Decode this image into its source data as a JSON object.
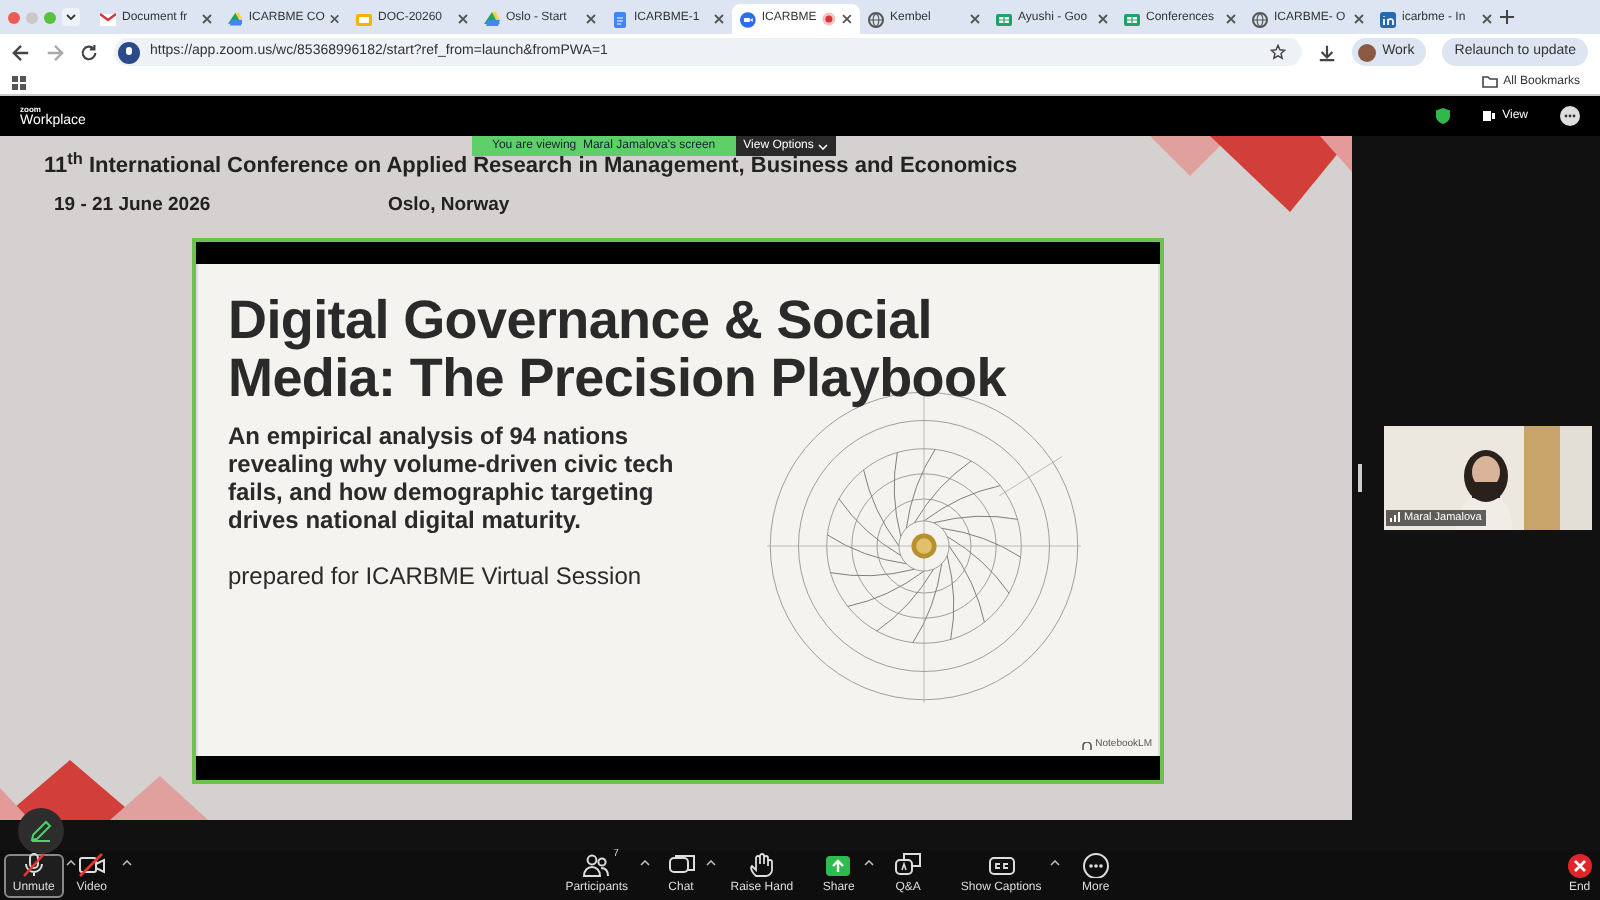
{
  "browser": {
    "tabs": [
      {
        "label": "Document fr",
        "selected": false,
        "recording": false,
        "kind": "mail"
      },
      {
        "label": "ICARBME CO",
        "selected": false,
        "recording": false,
        "kind": "drive"
      },
      {
        "label": "DOC-20260",
        "selected": false,
        "recording": false,
        "kind": "slides"
      },
      {
        "label": "Oslo - Start",
        "selected": false,
        "recording": false,
        "kind": "drive"
      },
      {
        "label": "ICARBME-1",
        "selected": false,
        "recording": false,
        "kind": "doc"
      },
      {
        "label": "ICARBME",
        "selected": true,
        "recording": true,
        "kind": "zoom"
      },
      {
        "label": "Kembel",
        "selected": false,
        "recording": false,
        "kind": "globe"
      },
      {
        "label": "Ayushi - Goo",
        "selected": false,
        "recording": false,
        "kind": "sheet"
      },
      {
        "label": "Conferences",
        "selected": false,
        "recording": false,
        "kind": "sheet"
      },
      {
        "label": "ICARBME- O",
        "selected": false,
        "recording": false,
        "kind": "globe"
      },
      {
        "label": "icarbme - In",
        "selected": false,
        "recording": false,
        "kind": "linkedin"
      }
    ],
    "url": "https://app.zoom.us/wc/85368996182/start?ref_from=launch&fromPWA=1",
    "profile": "Work",
    "relaunch": "Relaunch to update",
    "bookmarks": "All Bookmarks"
  },
  "zoom": {
    "brand_small": "zoom",
    "brand": "Workplace",
    "view": "View"
  },
  "share_banner": {
    "text": "You are viewing  Maral Jamalova's screen",
    "options": "View Options"
  },
  "slide": {
    "conference": "11$^{th}$ International Conference on Applied Research in Management, Business and Economics",
    "dates": "19 - 21 June 2026",
    "place": "Oslo, Norway",
    "title": "Digital Governance & Social Media: The Precision Playbook",
    "subtitle": "An empirical analysis of 94 nations revealing why volume-driven civic tech fails, and how demographic targeting drives national digital maturity.",
    "prepared": "prepared for ICARBME Virtual Session",
    "credit": "NotebookLM"
  },
  "video_tile": {
    "name": "Maral Jamalova"
  },
  "toolbar": [
    {
      "kind": "mic-off",
      "label": "Unmute",
      "selected": true,
      "menu": true
    },
    {
      "kind": "video",
      "label": "Video",
      "selected": false,
      "menu": true
    },
    {
      "kind": "participants",
      "label": "Participants",
      "count": "7",
      "selected": false,
      "menu": true
    },
    {
      "kind": "chat",
      "label": "Chat",
      "selected": false,
      "menu": true
    },
    {
      "kind": "hand",
      "label": "Raise Hand",
      "selected": false,
      "menu": false
    },
    {
      "kind": "share",
      "label": "Share",
      "selected": false,
      "menu": true
    },
    {
      "kind": "qa",
      "label": "Q&A",
      "selected": false,
      "menu": false
    },
    {
      "kind": "captions",
      "label": "Show Captions",
      "selected": false,
      "menu": true
    },
    {
      "kind": "more",
      "label": "More",
      "selected": false,
      "menu": false
    },
    {
      "kind": "end",
      "label": "End",
      "selected": false,
      "menu": false
    }
  ]
}
